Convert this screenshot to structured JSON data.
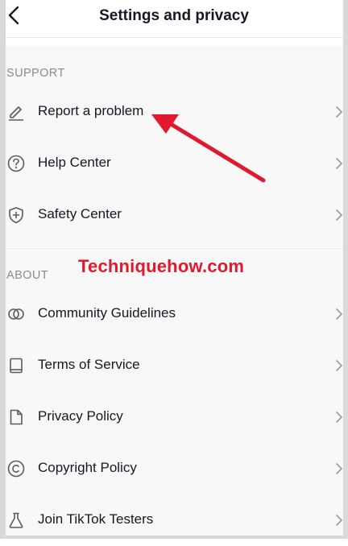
{
  "header": {
    "title": "Settings and privacy",
    "back_icon": "chevron-left-icon"
  },
  "support": {
    "heading": "SUPPORT",
    "items": [
      {
        "label": "Report a problem",
        "icon": "pencil-icon"
      },
      {
        "label": "Help Center",
        "icon": "question-circle-icon"
      },
      {
        "label": "Safety Center",
        "icon": "shield-plus-icon"
      }
    ]
  },
  "about": {
    "heading": "ABOUT",
    "items": [
      {
        "label": "Community Guidelines",
        "icon": "linked-circles-icon"
      },
      {
        "label": "Terms of Service",
        "icon": "book-icon"
      },
      {
        "label": "Privacy Policy",
        "icon": "document-icon"
      },
      {
        "label": "Copyright Policy",
        "icon": "copyright-icon"
      },
      {
        "label": "Join TikTok Testers",
        "icon": "flask-icon"
      }
    ]
  },
  "watermark": "Techniquehow.com",
  "colors": {
    "annotation": "#e1192f",
    "section_bg": "#f8f8f8",
    "text": "#161823",
    "muted": "#8a8b91"
  }
}
